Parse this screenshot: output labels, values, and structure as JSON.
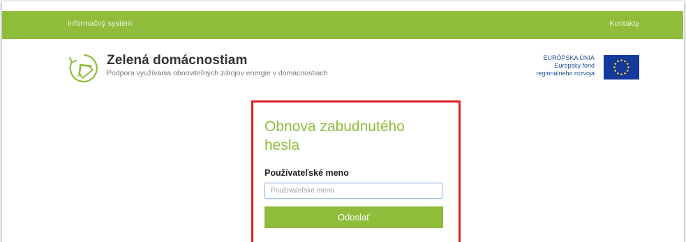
{
  "nav": {
    "left_link": "Informačný systém",
    "right_link": "Kontakty"
  },
  "brand": {
    "title": "Zelená domácnostiam",
    "subtitle": "Podpora využívania obnoviteľných zdrojov energie v domácnostiach",
    "logo_icon": "house-arrow-cycle-icon"
  },
  "eu_badge": {
    "line1": "EURÓPSKA ÚNIA",
    "line2": "Európsky fond",
    "line3": "regionálneho rozvoja",
    "flag_icon": "eu-flag-icon"
  },
  "form": {
    "title": "Obnova zabudnutého hesla",
    "username_label": "Používateľské meno",
    "username_placeholder": "Používateľské meno",
    "username_value": "",
    "submit_label": "Odoslať"
  },
  "colors": {
    "accent_green": "#8fbc3b",
    "highlight_red": "#e02020",
    "eu_blue": "#14389c",
    "eu_star": "#ffdd00"
  }
}
